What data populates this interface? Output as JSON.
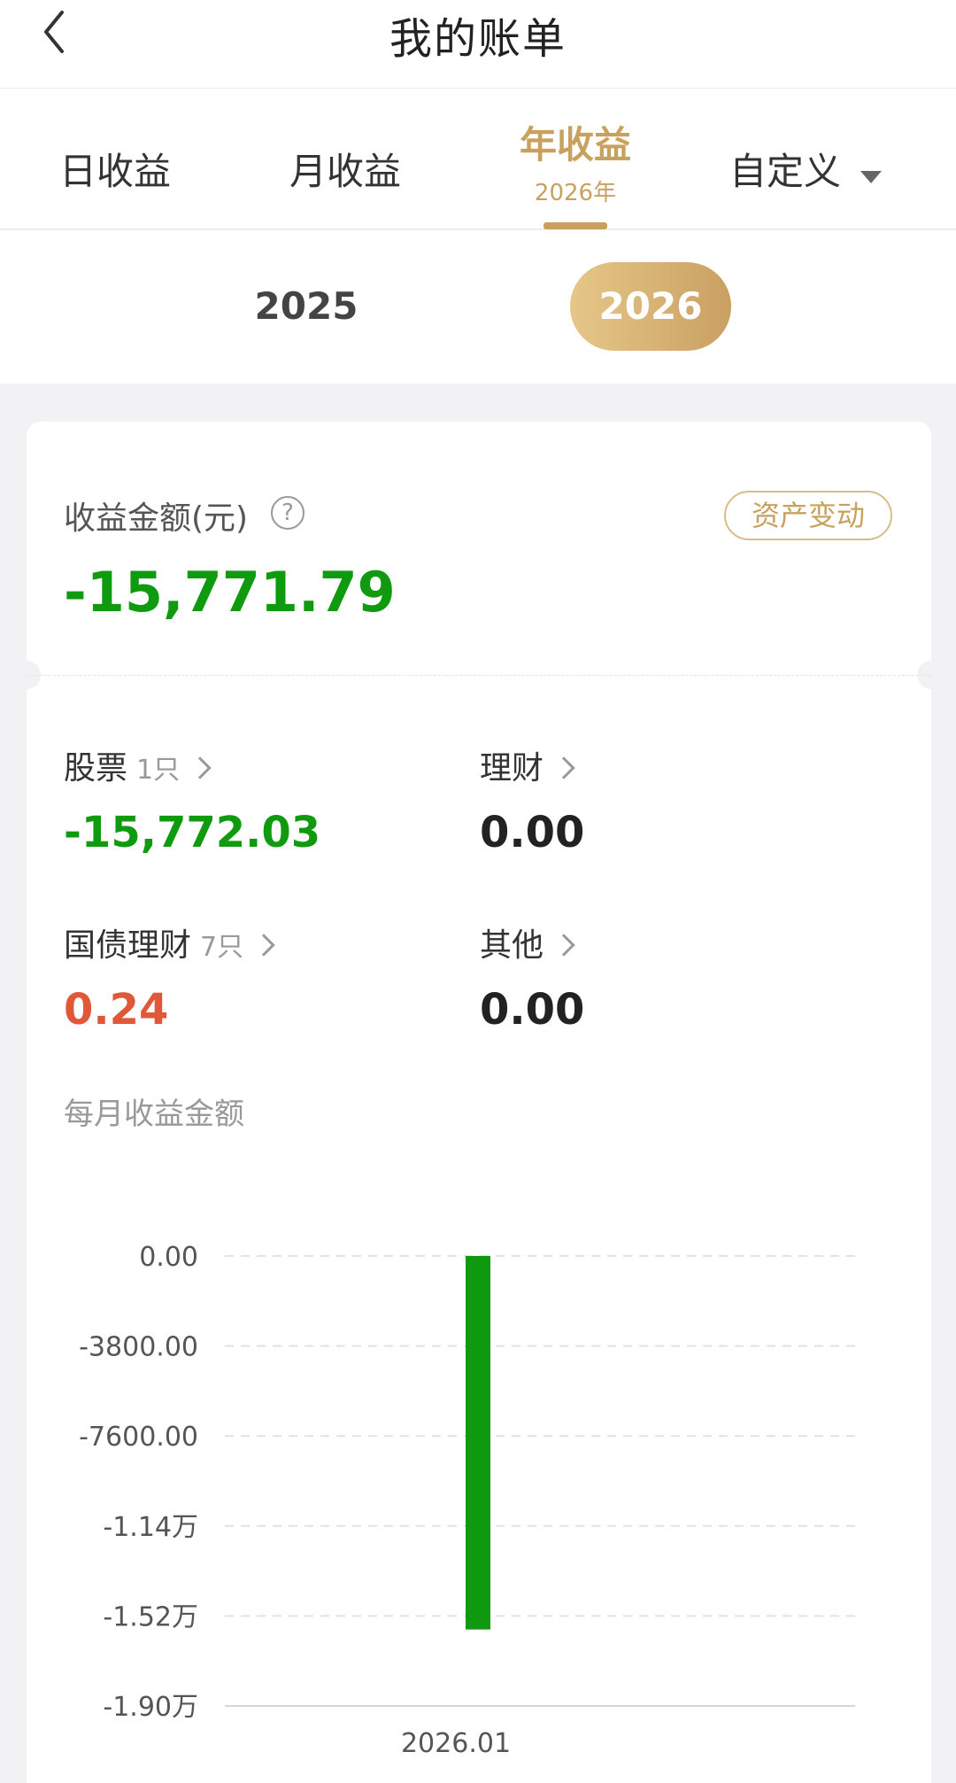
{
  "header": {
    "title": "我的账单"
  },
  "tabs": {
    "day": "日收益",
    "month": "月收益",
    "year": "年收益",
    "year_sub": "2026年",
    "custom": "自定义"
  },
  "years": [
    "2025",
    "2026"
  ],
  "selected_year": "2026",
  "summary": {
    "label": "收益金额(元)",
    "help": "?",
    "asset_button": "资产变动",
    "value": "-15,771.79"
  },
  "categories": {
    "stock": {
      "name": "股票",
      "count": "1只",
      "value": "-15,772.03"
    },
    "finance": {
      "name": "理财",
      "value": "0.00"
    },
    "bond": {
      "name": "国债理财",
      "count": "7只",
      "value": "0.24"
    },
    "other": {
      "name": "其他",
      "value": "0.00"
    }
  },
  "monthly": {
    "label": "每月收益金额"
  },
  "colors": {
    "accent": "#c8a15f",
    "negative": "#0f9a0f",
    "positive": "#e0573a"
  },
  "chart_data": {
    "type": "bar",
    "categories": [
      "2026.01"
    ],
    "values": [
      -15771.79
    ],
    "ylim": [
      -19000,
      0
    ],
    "yticks": [
      0,
      -3800,
      -7600,
      -11400,
      -15200,
      -19000
    ],
    "ytick_labels": [
      "0.00",
      "-3800.00",
      "-7600.00",
      "-1.14万",
      "-1.52万",
      "-1.90万"
    ],
    "grid": true,
    "bar_color": "#0f9a0f"
  }
}
